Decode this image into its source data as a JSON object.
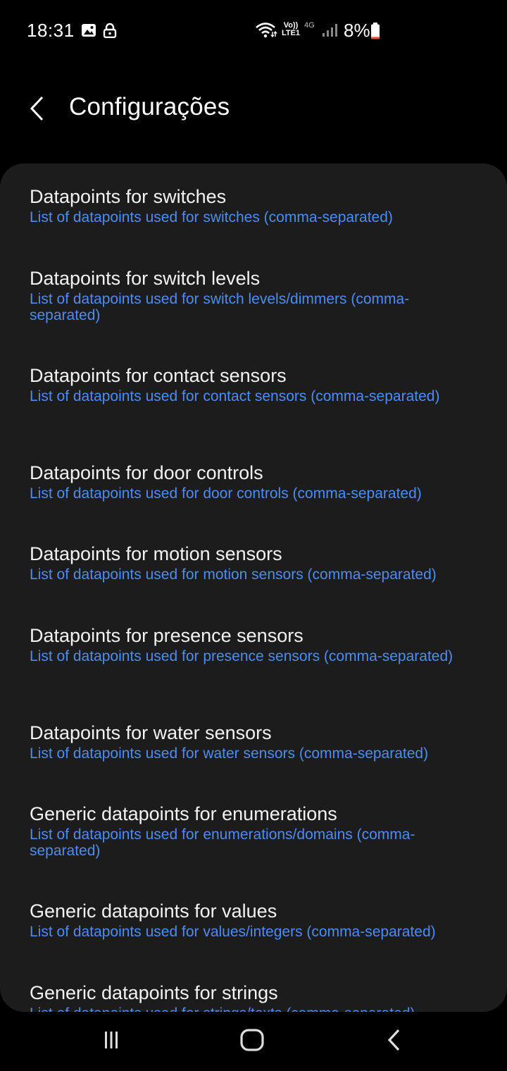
{
  "status_bar": {
    "time": "18:31",
    "battery_percent": "8%",
    "network_label_top": "Vo))",
    "network_label_bottom": "LTE1",
    "network_gen": "4G",
    "battery_level": 0.08,
    "battery_color": "#e5533d",
    "icons": [
      "gallery-icon",
      "lock-icon",
      "wifi-icon",
      "signal-icon",
      "battery-icon"
    ]
  },
  "app_bar": {
    "title": "Configurações",
    "back_icon": "chevron-left-icon"
  },
  "settings": {
    "items": [
      {
        "title": "Datapoints for switches",
        "summary": "List of datapoints used for switches (comma-separated)"
      },
      {
        "title": "Datapoints for switch levels",
        "summary": "List of datapoints used for switch levels/dimmers (comma-separated)"
      },
      {
        "title": "Datapoints for contact sensors",
        "summary": "List of datapoints used for contact sensors (comma-separated)"
      },
      {
        "title": "Datapoints for door controls",
        "summary": "List of datapoints used for door controls (comma-separated)"
      },
      {
        "title": "Datapoints for motion sensors",
        "summary": "List of datapoints used for motion sensors (comma-separated)"
      },
      {
        "title": "Datapoints for presence sensors",
        "summary": "List of datapoints used for presence sensors (comma-separated)"
      },
      {
        "title": "Datapoints for water sensors",
        "summary": "List of datapoints used for water sensors (comma-separated)"
      },
      {
        "title": "Generic datapoints for enumerations",
        "summary": "List of datapoints used for enumerations/domains (comma-separated)"
      },
      {
        "title": "Generic datapoints for values",
        "summary": "List of datapoints used for values/integers (comma-separated)"
      },
      {
        "title": "Generic datapoints for strings",
        "summary": "List of datapoints used for strings/texts (comma-separated)"
      }
    ]
  },
  "nav_bar": {
    "icons": [
      "recent-apps-icon",
      "home-icon",
      "back-icon"
    ]
  },
  "colors": {
    "background": "#000000",
    "card": "#1c1c1c",
    "title_text": "#f2f2f2",
    "summary_text": "#4b8df5"
  }
}
